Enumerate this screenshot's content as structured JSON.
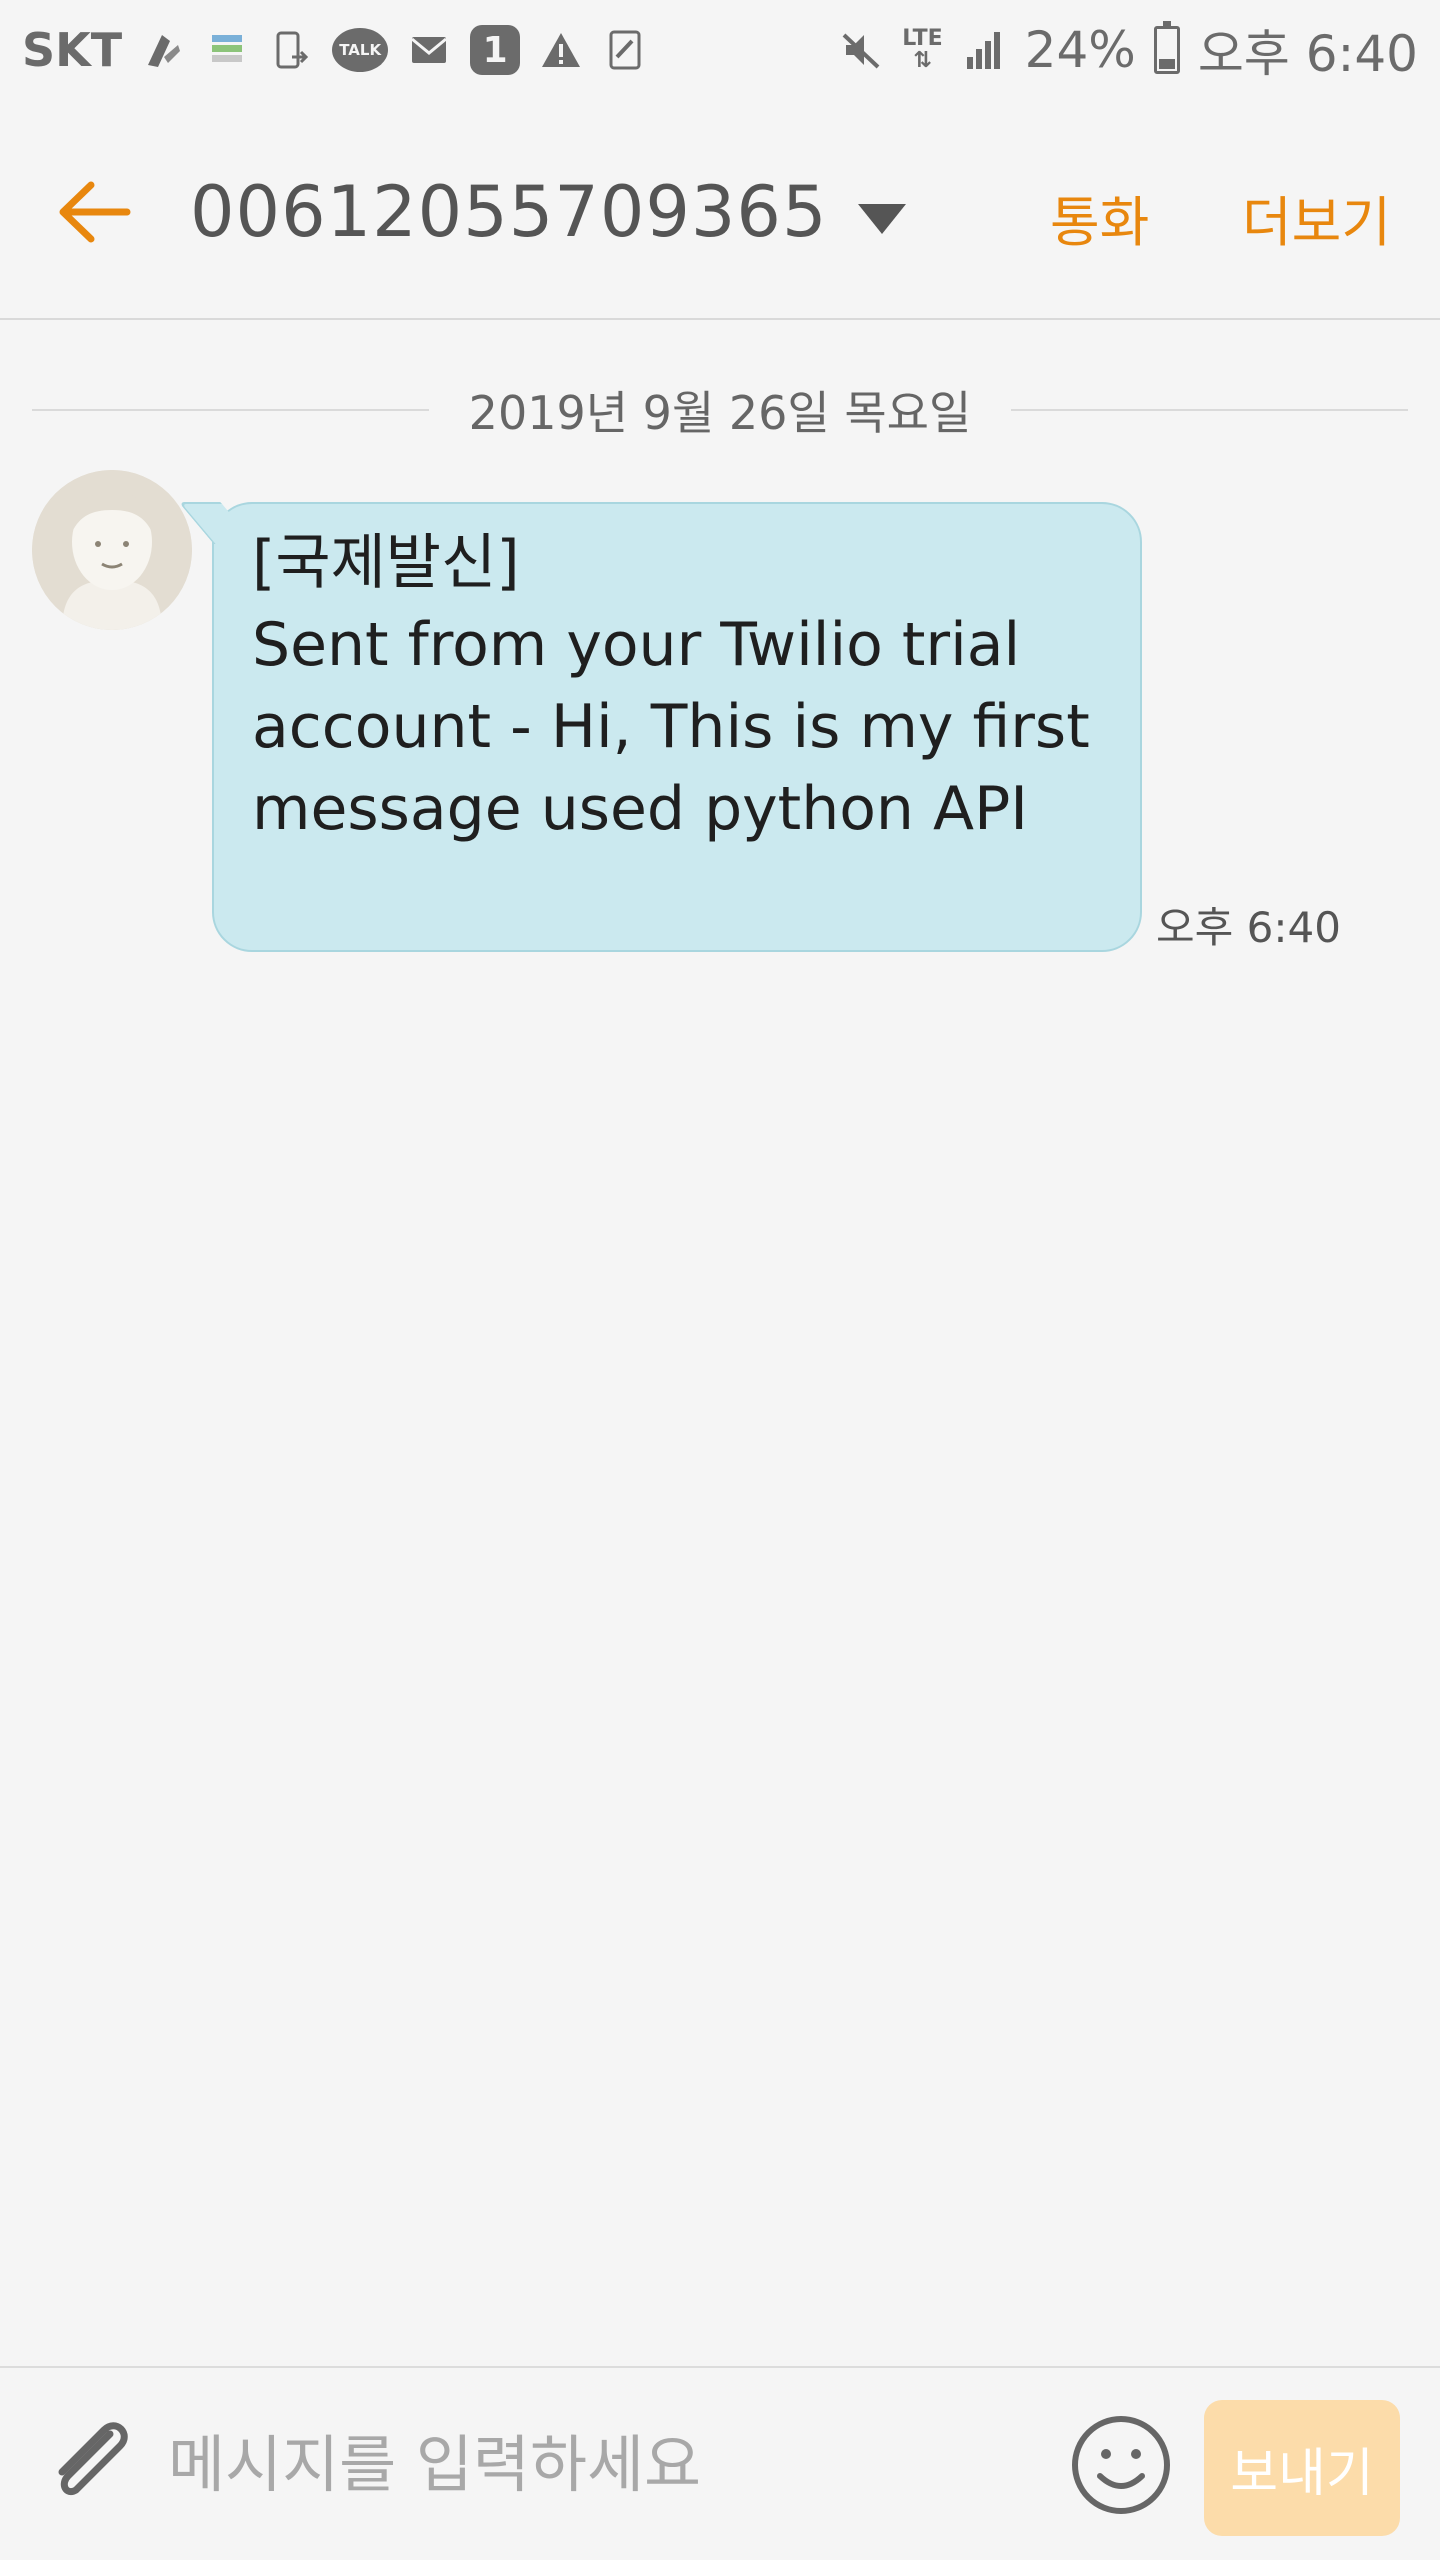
{
  "status_bar": {
    "carrier": "SKT",
    "talk_label": "TALK",
    "badge_count": "1",
    "network": "LTE",
    "battery_percent": "24%",
    "battery_level": 0.24,
    "time": "오후 6:40",
    "icons": [
      "sketch-app-icon",
      "calendar-icon",
      "phone-transfer-icon",
      "kakaotalk-icon",
      "mail-icon",
      "one-badge-icon",
      "warning-icon",
      "note-icon",
      "mute-icon",
      "lte-icon",
      "signal-icon",
      "battery-icon"
    ]
  },
  "app_bar": {
    "back_icon": "arrow-left-icon",
    "contact_number": "00612055709365",
    "dropdown_icon": "triangle-down-icon",
    "call_label": "통화",
    "more_label": "더보기"
  },
  "conversation": {
    "date": "2019년 9월 26일 목요일",
    "messages": [
      {
        "direction": "incoming",
        "text": "[국제발신]\nSent from your Twilio trial account - Hi, This is my first message used python API",
        "time": "오후 6:40"
      }
    ]
  },
  "composer": {
    "placeholder": "메시지를 입력하세요",
    "value": "",
    "send_label": "보내기",
    "attach_icon": "paperclip-icon",
    "emoji_icon": "smiley-icon"
  },
  "colors": {
    "accent": "#e8870e",
    "bubble_bg": "#cbe9ef",
    "bubble_border": "#a9d6df",
    "background": "#f5f5f5",
    "send_disabled": "#fcdcaa"
  }
}
